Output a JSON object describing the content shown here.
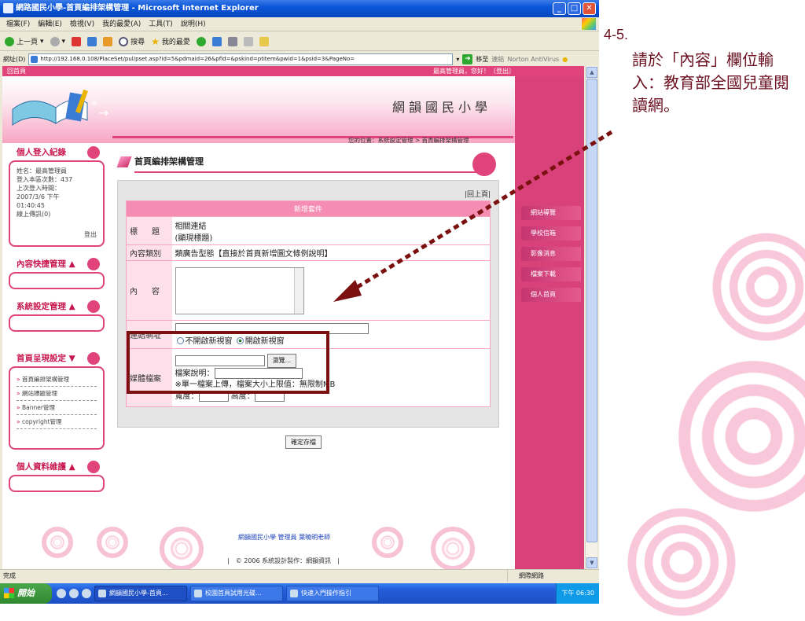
{
  "window": {
    "title": "網路國民小學-首頁編排架構管理 - Microsoft Internet Explorer",
    "min": "_",
    "max": "□",
    "close": "✕"
  },
  "menu": [
    "檔案(F)",
    "編輯(E)",
    "檢視(V)",
    "我的最愛(A)",
    "工具(T)",
    "說明(H)"
  ],
  "toolbar": {
    "back": "上一頁",
    "search": "搜尋",
    "favorites": "我的最愛"
  },
  "address": {
    "label": "網址(D)",
    "url": "http://192.168.0.108/PlaceSet/pul/pset.asp?id=5&pdmaid=26&pfid=&pskind=ptitem&pwid=1&psid=3&PageNo=",
    "go": "移至",
    "links": "連結",
    "norton": "Norton AntiVirus"
  },
  "page": {
    "home_link": "回首頁",
    "greeting": "最高管理員，您好！〔登出〕",
    "school_name": "網韻國民小學",
    "breadcrumb": "您的位置：系統設定管理 > 首頁編排架構管理",
    "right_nav": [
      "網站導覽",
      "學校信箱",
      "影像消息",
      "檔案下載",
      "個人首頁"
    ],
    "login_box": {
      "title": "個人登入紀錄",
      "lines": [
        "姓名：最高管理員",
        "登入本區次數：437",
        "上次登入時間：",
        "2007/3/6 下午",
        "01:40:45",
        "線上傳訊(0)"
      ],
      "logout": "登出"
    },
    "left_sections": [
      {
        "title": "內容快捷管理"
      },
      {
        "title": "系統設定管理"
      },
      {
        "title": "首頁呈現設定",
        "items": [
          "首頁編排架構管理",
          "網站標題管理",
          "Banner管理",
          "copyright管理"
        ]
      },
      {
        "title": "個人資料維護"
      }
    ],
    "main_title": "首頁編排架構管理",
    "back_link": "|回上頁|",
    "form": {
      "header": "新增套件",
      "title_label": "標　題",
      "title_value": "相關連結",
      "title_value2": "(顯現標題)",
      "type_label": "內容類別",
      "type_value": "類廣告型態【直接於首頁新增圖文條例說明】",
      "content_label": "內　容",
      "link_label": "連結網址",
      "radio_no": "不開啟新視窗",
      "radio_yes": "開啟新視窗",
      "media_label": "媒體檔案",
      "browse": "瀏覽...",
      "file_desc": "檔案說明：",
      "file_note": "※單一檔案上傳，檔案大小上限值：無限制MB",
      "width": "寬度：",
      "height": "高度："
    },
    "save": "確定存檔",
    "footer_credit": "網韻國民小學 管理員 葉曉明老師",
    "footer_copy": "|　© 2006 系統設計製作：網韻資訊　|"
  },
  "statusbar": {
    "text": "完成",
    "zone": "網際網路"
  },
  "taskbar": {
    "start": "開始",
    "tasks": [
      "網韻國民小學-首頁...",
      "校園首頁試用光碟...",
      "快速入門操作指引"
    ],
    "clock": "下午 06:30"
  },
  "slide": {
    "step": "4-5.",
    "text": "請於「內容」欄位輸入：教育部全國兒童閱讀網。"
  }
}
